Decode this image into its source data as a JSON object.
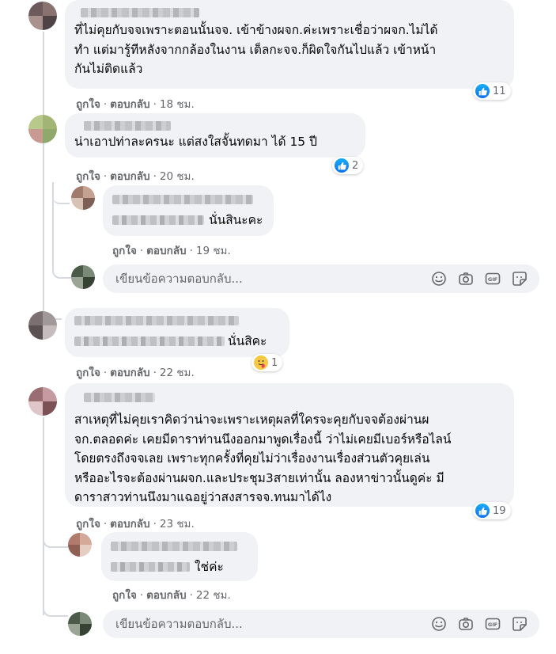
{
  "actions": {
    "like": "ถูกใจ",
    "reply": "ตอบกลับ",
    "separator": "·"
  },
  "reply_box": {
    "placeholder": "เขียนข้อความตอบกลับ..."
  },
  "comments": [
    {
      "text": "ที่ไม่คุยกับจจเพราะตอนนั้นจจ. เข้าข้างผจก.ค่ะเพราะเชื่อว่าผจก.ไม่ได้\nทำ แต่มารู้ทีหลังจากกล้องในงาน เต็ลกะจจ.ก็ผิดใจกันไปแล้ว เข้าหน้า\nกันไม่ติดแล้ว",
      "time": "18 ชม.",
      "reaction": "like",
      "reaction_count": "11"
    },
    {
      "text": "น่าเอาปท่าละครนะ แต่สงใสจั้นทดมา ได้ 15 ปี",
      "time": "20 ชม.",
      "reaction": "like",
      "reaction_count": "2"
    },
    {
      "text": "นั่นสินะคะ",
      "time": "19 ชม.",
      "reply": true
    },
    {
      "text": "นั่นสิคะ",
      "time": "22 ชม.",
      "reaction": "care",
      "reaction_count": "1"
    },
    {
      "text": "สาเหตุที่ไม่คุยเราคิดว่าน่าจะเพราะเหตุผลที่ใครจะคุยกับจจต้องผ่านผ\nจก.ตลอดค่ะ เคยมีดาราท่านนึงออกมาพูดเรื่องนี้ ว่าไม่เคยมีเบอร์หรือไลน์\nโดยตรงถึงจจเลย เพราะทุกครั้งที่คุยไม่ว่าเรื่องงานเรื่องส่วนตัวคุยเล่น\nหรืออะไรจะต้องผ่านผจก.และประชุม3สายเท่านั้น ลองหาข่าวนั้นดูค่ะ มี\nดาราสาวท่านนึงมาแฉอยู่ว่าสงสารจจ.ทนมาได้ไง",
      "time": "23 ชม.",
      "reaction": "like",
      "reaction_count": "19"
    },
    {
      "text": "ใช่ค่ะ",
      "time": "22 ชม.",
      "reply": true
    }
  ],
  "icons": [
    "smile-icon",
    "camera-icon",
    "gif-icon",
    "sticker-icon"
  ],
  "colors": {
    "bubble": "#f0f2f5",
    "meta": "#65676b",
    "like": "#0b6ff0",
    "thread": "#d6d9dd"
  }
}
